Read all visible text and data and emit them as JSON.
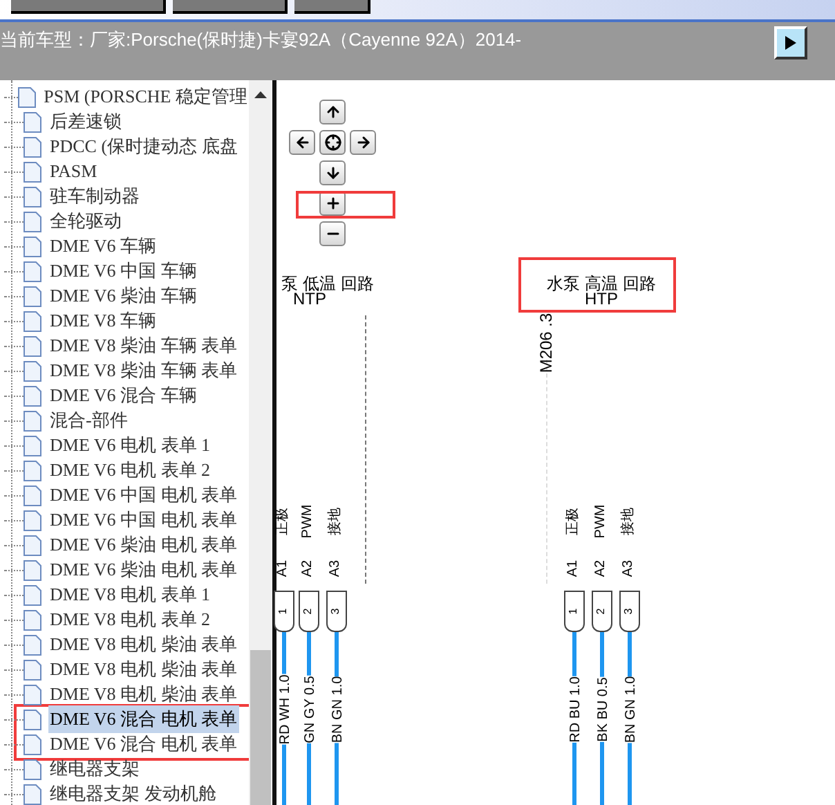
{
  "vehicle_bar": {
    "label": "当前车型：",
    "value": "厂家:Porsche(保时捷)卡宴92A（Cayenne 92A）2014-"
  },
  "tree": {
    "items": [
      {
        "label": "PSM (PORSCHE 稳定管理",
        "selected": false
      },
      {
        "label": "后差速锁",
        "selected": false
      },
      {
        "label": "PDCC (保时捷动态 底盘",
        "selected": false
      },
      {
        "label": "PASM",
        "selected": false
      },
      {
        "label": "驻车制动器",
        "selected": false
      },
      {
        "label": "全轮驱动",
        "selected": false
      },
      {
        "label": "DME V6 车辆",
        "selected": false
      },
      {
        "label": "DME V6 中国 车辆",
        "selected": false
      },
      {
        "label": "DME V6 柴油 车辆",
        "selected": false
      },
      {
        "label": "DME V8 车辆",
        "selected": false
      },
      {
        "label": "DME V8 柴油 车辆 表单",
        "selected": false
      },
      {
        "label": "DME V8 柴油 车辆 表单",
        "selected": false
      },
      {
        "label": "DME V6 混合 车辆",
        "selected": false
      },
      {
        "label": "混合-部件",
        "selected": false
      },
      {
        "label": "DME V6 电机 表单 1",
        "selected": false
      },
      {
        "label": "DME V6 电机 表单 2",
        "selected": false
      },
      {
        "label": "DME V6 中国 电机 表单",
        "selected": false
      },
      {
        "label": "DME V6 中国 电机 表单",
        "selected": false
      },
      {
        "label": "DME V6 柴油 电机 表单",
        "selected": false
      },
      {
        "label": "DME V6 柴油 电机 表单",
        "selected": false
      },
      {
        "label": "DME V8 电机 表单 1",
        "selected": false
      },
      {
        "label": "DME V8 电机 表单 2",
        "selected": false
      },
      {
        "label": "DME V8 电机 柴油 表单",
        "selected": false
      },
      {
        "label": "DME V8 电机 柴油 表单",
        "selected": false
      },
      {
        "label": "DME V8 电机 柴油 表单",
        "selected": false
      },
      {
        "label": "DME V6 混合 电机 表单",
        "selected": true
      },
      {
        "label": "DME V6 混合 电机 表单",
        "selected": false
      },
      {
        "label": "继电器支架",
        "selected": false
      },
      {
        "label": "继电器支架 发动机舱",
        "selected": false
      }
    ]
  },
  "diagram": {
    "component_label": "M206 .3",
    "circuits": [
      {
        "title": "泵 低温 回路",
        "code": "NTP",
        "pins": [
          {
            "function": "正极",
            "pin": "A1",
            "number": "1",
            "wire": "RD WH 1.0"
          },
          {
            "function": "PWM",
            "pin": "A2",
            "number": "2",
            "wire": "GN GY 0.5"
          },
          {
            "function": "接地",
            "pin": "A3",
            "number": "3",
            "wire": "BN GN 1.0"
          }
        ]
      },
      {
        "title": "水泵 高温 回路",
        "code": "HTP",
        "pins": [
          {
            "function": "正极",
            "pin": "A1",
            "number": "1",
            "wire": "RD BU 1.0"
          },
          {
            "function": "PWM",
            "pin": "A2",
            "number": "2",
            "wire": "BK BU 0.5"
          },
          {
            "function": "接地",
            "pin": "A3",
            "number": "3",
            "wire": "BN GN 1.0"
          }
        ]
      }
    ]
  }
}
